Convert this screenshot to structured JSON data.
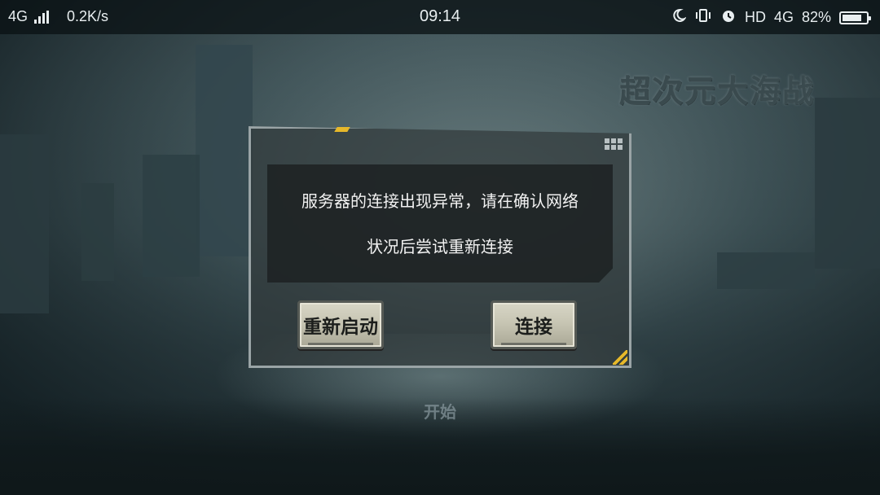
{
  "status_bar": {
    "network": "4G",
    "speed": "0.2K/s",
    "time": "09:14",
    "hd_label": "HD",
    "network_right": "4G",
    "battery_percent": "82%",
    "battery_level": 0.82,
    "icons": [
      "signal-icon",
      "moon-icon",
      "vibrate-icon",
      "alarm-icon",
      "battery-icon"
    ]
  },
  "game": {
    "logo_text": "超次元大海战",
    "start_label": "开始"
  },
  "dialog": {
    "message_line1": "服务器的连接出现异常，请在确认网络",
    "message_line2": "状况后尝试重新连接",
    "restart_label": "重新启动",
    "connect_label": "连接"
  },
  "colors": {
    "accent": "#e6b82a",
    "button_face": "#c5c3b1"
  }
}
